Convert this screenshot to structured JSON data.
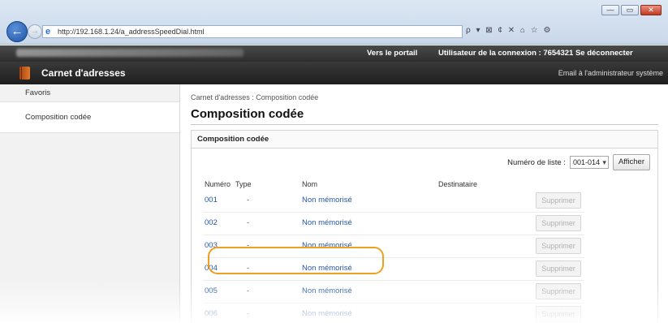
{
  "browser": {
    "url": "http://192.168.1.24/a_addressSpeedDial.html",
    "toolbar_glyphs": "ρ ▾ ⊠ ¢ ✕   ⌂ ☆ ⚙",
    "win_minimize": "—",
    "win_maximize": "▭",
    "win_close": "✕",
    "back_glyph": "←",
    "forward_glyph": "→"
  },
  "top_strip": {
    "portal_link": "Vers le portail",
    "user_info": "Utilisateur de la connexion : 7654321  Se déconnecter"
  },
  "header": {
    "title": "Carnet d'adresses",
    "admin_mail": "Email à l'administrateur système"
  },
  "sidebar": {
    "items": [
      {
        "label": "Favoris"
      },
      {
        "label": "Composition codée"
      }
    ]
  },
  "main": {
    "breadcrumb": "Carnet d'adresses : Composition codée",
    "title": "Composition codée",
    "section_title": "Composition codée",
    "list_label": "Numéro de liste :",
    "list_value": "001-014",
    "show_button": "Afficher",
    "columns": {
      "number": "Numéro",
      "type": "Type",
      "name": "Nom",
      "recipient": "Destinataire"
    },
    "delete_label": "Supprimer",
    "rows": [
      {
        "number": "001",
        "type": "-",
        "name": "Non mémorisé"
      },
      {
        "number": "002",
        "type": "-",
        "name": "Non mémorisé"
      },
      {
        "number": "003",
        "type": "-",
        "name": "Non mémorisé"
      },
      {
        "number": "004",
        "type": "-",
        "name": "Non mémorisé"
      },
      {
        "number": "005",
        "type": "-",
        "name": "Non mémorisé"
      },
      {
        "number": "006",
        "type": "-",
        "name": "Non mémorisé"
      }
    ],
    "highlight_color": "#f0a020",
    "link_color": "#2656a8"
  }
}
